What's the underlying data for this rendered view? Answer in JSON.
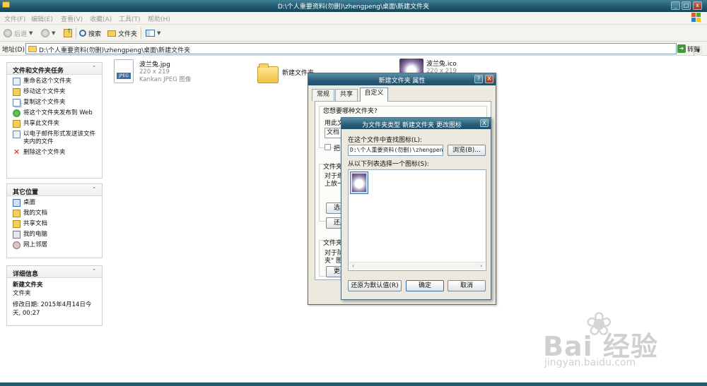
{
  "window": {
    "title": "D:\\个人重要资料(勿删)\\zhengpeng\\桌面\\新建文件夹",
    "min_label": "_",
    "max_label": "□",
    "close_label": "x"
  },
  "menu": [
    "文件(F)",
    "编辑(E)",
    "查看(V)",
    "收藏(A)",
    "工具(T)",
    "帮助(H)"
  ],
  "toolbar": {
    "back_label": "后退",
    "search_label": "搜索",
    "folders_label": "文件夹"
  },
  "address": {
    "label": "地址(D)",
    "path": "D:\\个人重要资料(勿删)\\zhengpeng\\桌面\\新建文件夹",
    "go_label": "转到"
  },
  "tasks_panel": {
    "title": "文件和文件夹任务",
    "items": [
      {
        "label": "重命名这个文件夹",
        "icon": "rename-icon"
      },
      {
        "label": "移动这个文件夹",
        "icon": "move-icon"
      },
      {
        "label": "复制这个文件夹",
        "icon": "copy-icon"
      },
      {
        "label": "将这个文件夹发布到 Web",
        "icon": "publish-web-icon"
      },
      {
        "label": "共享此文件夹",
        "icon": "share-icon"
      },
      {
        "label": "以电子邮件形式发送该文件夹内的文件",
        "icon": "email-icon"
      },
      {
        "label": "删除这个文件夹",
        "icon": "delete-icon"
      }
    ]
  },
  "places_panel": {
    "title": "其它位置",
    "items": [
      {
        "label": "桌面",
        "icon": "desktop-icon"
      },
      {
        "label": "我的文档",
        "icon": "my-documents-icon"
      },
      {
        "label": "共享文档",
        "icon": "shared-docs-icon"
      },
      {
        "label": "我的电脑",
        "icon": "my-computer-icon"
      },
      {
        "label": "网上邻居",
        "icon": "network-icon"
      }
    ]
  },
  "details_panel": {
    "title": "详细信息",
    "name": "新建文件夹",
    "type": "文件夹",
    "modified": "修改日期: 2015年4月14日今天, 00:27"
  },
  "files": [
    {
      "name": "波兰兔.jpg",
      "dims": "220 x 219",
      "desc": "Kankan JPEG 图像"
    },
    {
      "name": "新建文件夹"
    },
    {
      "name": "波兰兔.ico",
      "dims": "220 x 219"
    }
  ],
  "properties_dialog": {
    "title": "新建文件夹 属性",
    "help_label": "?",
    "close_label": "X",
    "tabs": [
      "常规",
      "共享",
      "自定义"
    ],
    "q1": "您想要哪种文件夹?",
    "use_as": "用此文",
    "template_value": "文档",
    "checkbox_label": "把",
    "section2": "文件夹",
    "section2_line1": "对于缩",
    "section2_line2": "上放一",
    "choose_btn": "选择",
    "restore_btn": "还原",
    "section3": "文件夹",
    "section3_line1": "对于除",
    "section3_line2": "夹\" 图",
    "change_btn": "更改"
  },
  "icon_dialog": {
    "title": "为文件夹类型 新建文件夹 更改图标",
    "close_label": "X",
    "find_label": "在这个文件中查找图标(L):",
    "path_value": "D:\\个人重要资料(勿删)\\zhengpeng",
    "browse_btn": "浏览(B)...",
    "choose_label": "从以下列表选择一个图标(S):",
    "restore_btn": "还原为默认值(R)",
    "ok_btn": "确定",
    "cancel_btn": "取消"
  },
  "watermark": {
    "paw": "❀",
    "main": "Bai 经验",
    "sub": "jingyan.baidu.com"
  },
  "colors": {
    "titlebar": "#2a5d78",
    "chrome": "#f4f3ee",
    "dialog_bg": "#eceadf",
    "selection": "#cfe0f3"
  }
}
